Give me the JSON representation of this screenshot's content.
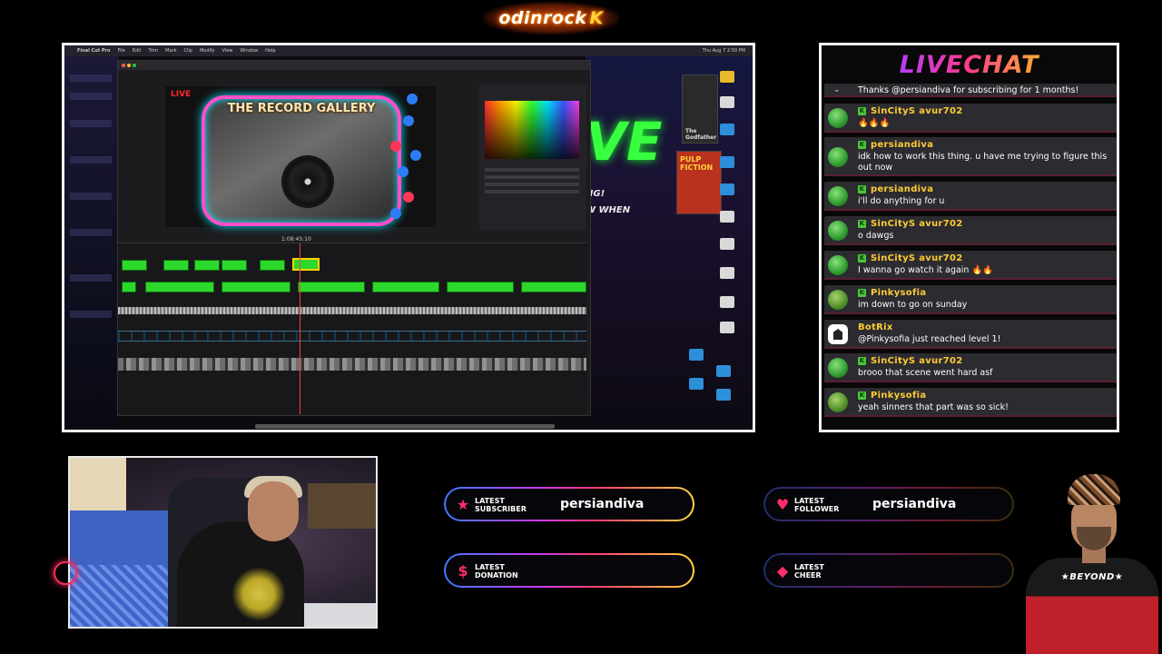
{
  "logo": {
    "main": "odinrock",
    "suffix": "K"
  },
  "screen": {
    "app_name": "Final Cut Pro",
    "menu": [
      "File",
      "Edit",
      "Trim",
      "Mark",
      "Clip",
      "Modify",
      "View",
      "Window",
      "Help"
    ],
    "clock": "Thu Aug 7  2:50 PM",
    "viewer_live_tag": "LIVE",
    "viewer_title": "THE RECORD GALLERY",
    "timecode": "1:08:45:10",
    "neon_live": "VE",
    "neon_line_1": "NG!",
    "neon_line_2": "W WHEN",
    "poster_1": "The Godfather",
    "poster_2": "PULP FICTION"
  },
  "chat": {
    "title": "LIVECHAT",
    "messages": [
      {
        "user": "",
        "text": "Thanks @persiandiva for subscribing for 1 months!",
        "type": "system"
      },
      {
        "user": "SinCityS avur702",
        "text": "🔥🔥🔥",
        "type": "user"
      },
      {
        "user": "persiandiva",
        "text": "idk how to work this thing. u have me trying to figure this out now",
        "type": "user"
      },
      {
        "user": "persiandiva",
        "text": "i'll do anything for u",
        "type": "user"
      },
      {
        "user": "SinCityS avur702",
        "text": "o dawgs",
        "type": "user"
      },
      {
        "user": "SinCityS avur702",
        "text": "I wanna go watch it again 🔥🔥",
        "type": "user"
      },
      {
        "user": "Pinkysofia",
        "text": "im down to go on sunday",
        "type": "user"
      },
      {
        "user": "BotRix",
        "text": "@Pinkysofia just reached level 1!",
        "type": "bot"
      },
      {
        "user": "SinCityS avur702",
        "text": "brooo that scene went hard asf",
        "type": "user"
      },
      {
        "user": "Pinkysofia",
        "text": "yeah sinners that part was so sick!",
        "type": "user"
      }
    ],
    "colors": {
      "username": "#ffcc33",
      "badge": "#4cc53a"
    }
  },
  "latest": {
    "subscriber": {
      "label_1": "LATEST",
      "label_2": "SUBSCRIBER",
      "value": "persiandiva",
      "icon": "star-icon"
    },
    "follower": {
      "label_1": "LATEST",
      "label_2": "FOLLOWER",
      "value": "persiandiva",
      "icon": "heart-icon"
    },
    "donation": {
      "label_1": "LATEST",
      "label_2": "DONATION",
      "value": "",
      "icon": "dollar-icon"
    },
    "cheer": {
      "label_1": "LATEST",
      "label_2": "CHEER",
      "value": "",
      "icon": "diamond-icon"
    }
  },
  "presenter": {
    "shirt_text": "★BEYOND★"
  }
}
